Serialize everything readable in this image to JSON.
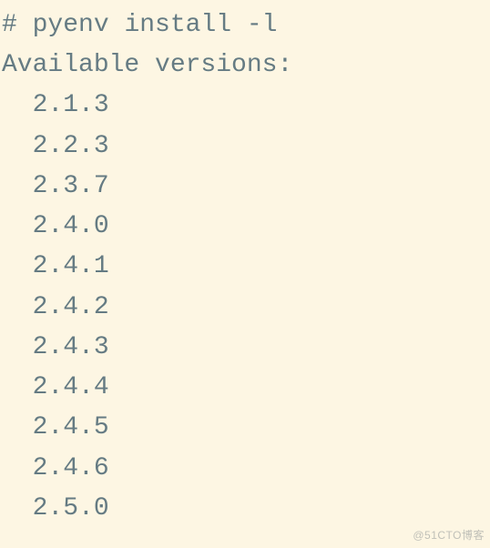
{
  "terminal": {
    "prompt_char": "#",
    "command": "pyenv install -l",
    "header": "Available versions:",
    "versions": [
      "2.1.3",
      "2.2.3",
      "2.3.7",
      "2.4.0",
      "2.4.1",
      "2.4.2",
      "2.4.3",
      "2.4.4",
      "2.4.5",
      "2.4.6",
      "2.5.0"
    ]
  },
  "watermark": "@51CTO博客"
}
